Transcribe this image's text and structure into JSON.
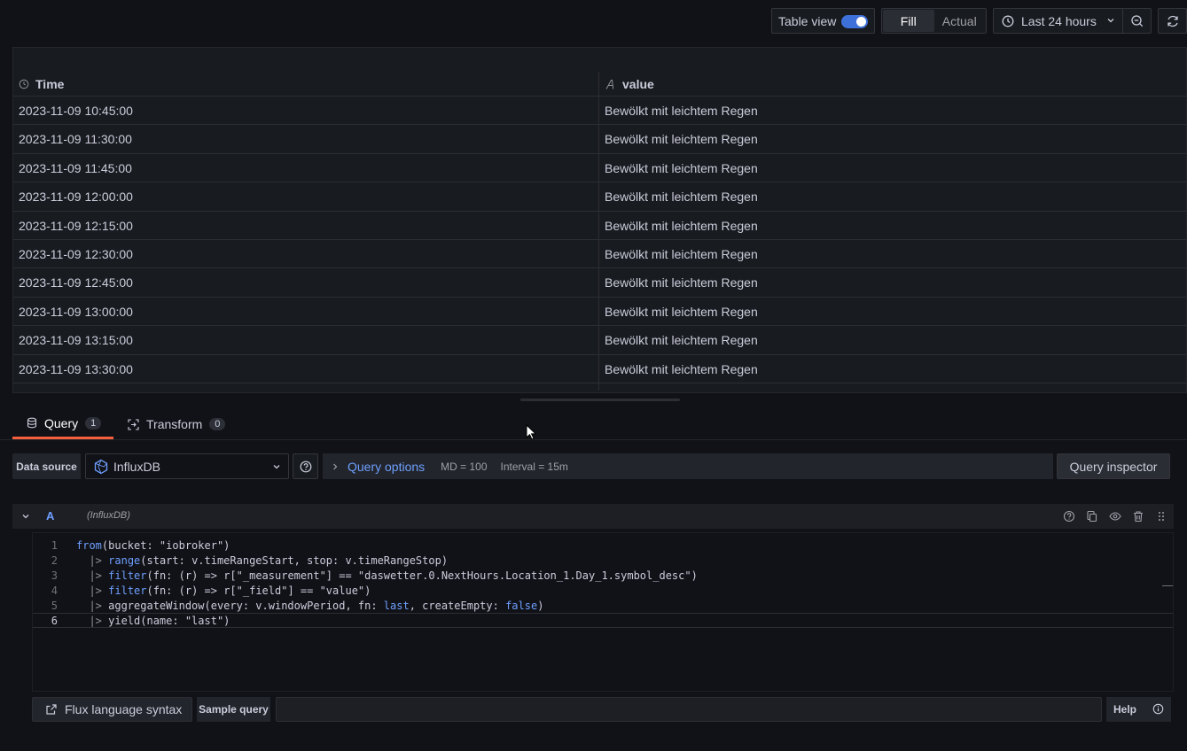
{
  "toolbar": {
    "table_view_label": "Table view",
    "table_view_on": true,
    "fill_label": "Fill",
    "actual_label": "Actual",
    "time_range_label": "Last 24 hours"
  },
  "table": {
    "columns": [
      "Time",
      "value"
    ],
    "rows": [
      {
        "time": "2023-11-09 10:45:00",
        "value": "Bewölkt mit leichtem Regen"
      },
      {
        "time": "2023-11-09 11:30:00",
        "value": "Bewölkt mit leichtem Regen"
      },
      {
        "time": "2023-11-09 11:45:00",
        "value": "Bewölkt mit leichtem Regen"
      },
      {
        "time": "2023-11-09 12:00:00",
        "value": "Bewölkt mit leichtem Regen"
      },
      {
        "time": "2023-11-09 12:15:00",
        "value": "Bewölkt mit leichtem Regen"
      },
      {
        "time": "2023-11-09 12:30:00",
        "value": "Bewölkt mit leichtem Regen"
      },
      {
        "time": "2023-11-09 12:45:00",
        "value": "Bewölkt mit leichtem Regen"
      },
      {
        "time": "2023-11-09 13:00:00",
        "value": "Bewölkt mit leichtem Regen"
      },
      {
        "time": "2023-11-09 13:15:00",
        "value": "Bewölkt mit leichtem Regen"
      },
      {
        "time": "2023-11-09 13:30:00",
        "value": "Bewölkt mit leichtem Regen"
      }
    ]
  },
  "tabs": [
    {
      "label": "Query",
      "count": "1"
    },
    {
      "label": "Transform",
      "count": "0"
    }
  ],
  "datasource": {
    "label": "Data source",
    "name": "InfluxDB",
    "query_options_label": "Query options",
    "md": "MD = 100",
    "interval": "Interval = 15m",
    "query_inspector_label": "Query inspector"
  },
  "query": {
    "ref_id": "A",
    "datasource_hint": "(InfluxDB)",
    "lines": [
      "from(bucket: \"iobroker\")",
      "  |> range(start: v.timeRangeStart, stop: v.timeRangeStop)",
      "  |> filter(fn: (r) => r[\"_measurement\"] == \"daswetter.0.NextHours.Location_1.Day_1.symbol_desc\")",
      "  |> filter(fn: (r) => r[\"_field\"] == \"value\")",
      "  |> aggregateWindow(every: v.windowPeriod, fn: last, createEmpty: false)",
      "  |> yield(name: \"last\")"
    ],
    "line_numbers": [
      "1",
      "2",
      "3",
      "4",
      "5",
      "6"
    ]
  },
  "bottom": {
    "flux_syntax_label": "Flux language syntax",
    "sample_query_label": "Sample query",
    "help_label": "Help"
  },
  "colors": {
    "accent_blue": "#6e9fff",
    "toggle_blue": "#3d71d9",
    "active_tab_orange": "#f55f3e"
  }
}
